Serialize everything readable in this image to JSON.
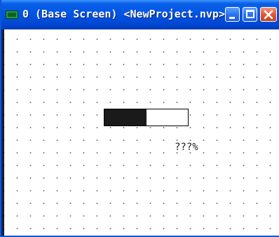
{
  "window": {
    "title": "0 (Base Screen) <NewProject.nvp>",
    "icons": {
      "app": "screen-icon",
      "minimize": "minimize-icon",
      "maximize": "maximize-icon",
      "close": "close-icon"
    }
  },
  "canvas": {
    "grid": "dotted",
    "progress_bar": {
      "fill_fraction": 0.5,
      "fill_color": "#1a1a1a",
      "track_color": "#ffffff"
    },
    "percent_label": "???%"
  },
  "colors": {
    "titlebar": "#0054e3",
    "close_button": "#e15a37"
  }
}
